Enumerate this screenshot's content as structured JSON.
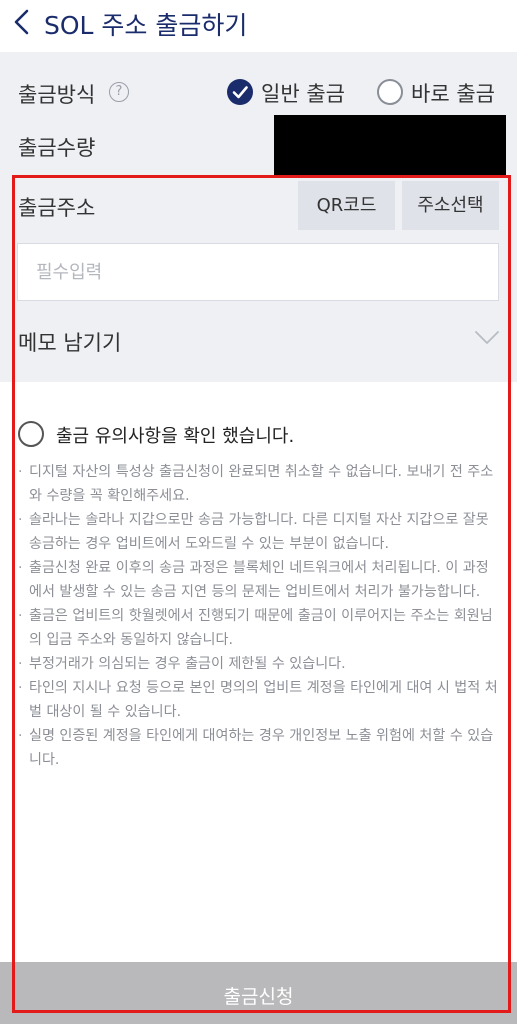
{
  "header": {
    "title": "SOL 주소 출금하기"
  },
  "withdrawal_method": {
    "label": "출금방식",
    "help_icon": "?",
    "options": [
      {
        "label": "일반 출금",
        "selected": true
      },
      {
        "label": "바로 출금",
        "selected": false
      }
    ]
  },
  "withdrawal_amount": {
    "label": "출금수량"
  },
  "withdrawal_address": {
    "label": "출금주소",
    "qr_button": "QR코드",
    "select_button": "주소선택",
    "input_placeholder": "필수입력",
    "input_value": ""
  },
  "memo": {
    "label": "메모 남기기"
  },
  "agreement": {
    "label": "출금 유의사항을 확인 했습니다.",
    "checked": false
  },
  "notices": [
    "디지털 자산의 특성상 출금신청이 완료되면 취소할 수 없습니다. 보내기 전 주소와 수량을 꼭 확인해주세요.",
    "솔라나는 솔라나 지갑으로만 송금 가능합니다. 다른 디지털 자산 지갑으로 잘못 송금하는 경우 업비트에서 도와드릴 수 있는 부분이 없습니다.",
    "출금신청 완료 이후의 송금 과정은 블록체인 네트워크에서 처리됩니다. 이 과정에서 발생할 수 있는 송금 지연 등의 문제는 업비트에서 처리가 불가능합니다.",
    "출금은 업비트의 핫월렛에서 진행되기 때문에 출금이 이루어지는 주소는 회원님의 입금 주소와 동일하지 않습니다.",
    "부정거래가 의심되는 경우 출금이 제한될 수 있습니다.",
    "타인의 지시나 요청 등으로 본인 명의의 업비트 계정을 타인에게 대여 시 법적 처벌 대상이 될 수 있습니다.",
    "실명 인증된 계정을 타인에게 대여하는 경우 개인정보 노출 위험에 처할 수 있습니다."
  ],
  "submit": {
    "label": "출금신청"
  },
  "colors": {
    "accent": "#1a2c6b",
    "form_background": "#eef0f4",
    "highlight_frame": "#e21a1a",
    "submit_disabled": "#b9b9bb"
  },
  "icons": {
    "back": "chevron-left-icon",
    "help": "question-circle-icon",
    "check": "check-circle-icon",
    "memo_toggle": "chevron-down-icon"
  }
}
